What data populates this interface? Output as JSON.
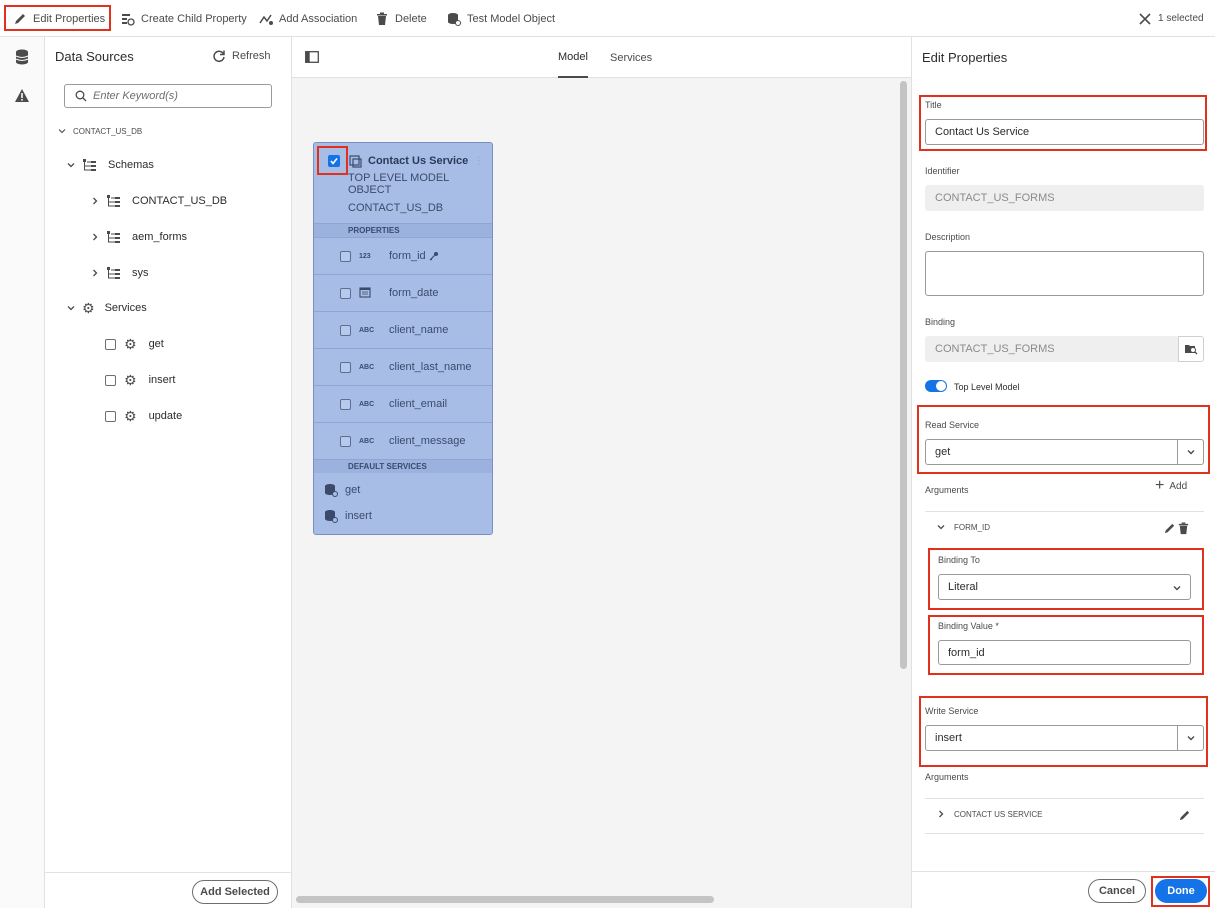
{
  "toolbar": {
    "edit_properties": "Edit Properties",
    "create_child_property": "Create Child Property",
    "add_association": "Add Association",
    "delete": "Delete",
    "test_model_object": "Test Model Object",
    "selected": "1 selected"
  },
  "data_sources": {
    "title": "Data Sources",
    "refresh": "Refresh",
    "search_placeholder": "Enter Keyword(s)",
    "root": "CONTACT_US_DB",
    "schemas_label": "Schemas",
    "schemas": [
      "CONTACT_US_DB",
      "aem_forms",
      "sys"
    ],
    "services_label": "Services",
    "services": [
      "get",
      "insert",
      "update"
    ],
    "add_selected": "Add Selected"
  },
  "canvas": {
    "tabs": [
      "Model",
      "Services"
    ],
    "active_tab": "Model",
    "card": {
      "title": "Contact Us Service",
      "subtitle": "TOP LEVEL MODEL OBJECT",
      "source": "CONTACT_US_DB",
      "properties_label": "PROPERTIES",
      "properties": [
        {
          "type": "123",
          "name": "form_id"
        },
        {
          "type": "date",
          "name": "form_date"
        },
        {
          "type": "ABC",
          "name": "client_name"
        },
        {
          "type": "ABC",
          "name": "client_last_name"
        },
        {
          "type": "ABC",
          "name": "client_email"
        },
        {
          "type": "ABC",
          "name": "client_message"
        }
      ],
      "default_services_label": "DEFAULT SERVICES",
      "default_services": [
        "get",
        "insert"
      ]
    }
  },
  "edit_panel": {
    "heading": "Edit Properties",
    "title_label": "Title",
    "title_value": "Contact Us Service",
    "identifier_label": "Identifier",
    "identifier_value": "CONTACT_US_FORMS",
    "description_label": "Description",
    "description_value": "",
    "binding_label": "Binding",
    "binding_value": "CONTACT_US_FORMS",
    "top_level_label": "Top Level Model",
    "read_service_label": "Read Service",
    "read_service_value": "get",
    "arguments_label": "Arguments",
    "add_label": "Add",
    "argument_name": "FORM_ID",
    "binding_to_label": "Binding To",
    "binding_to_value": "Literal",
    "binding_value_label": "Binding Value *",
    "binding_value_value": "form_id",
    "write_service_label": "Write Service",
    "write_service_value": "insert",
    "write_arguments_label": "Arguments",
    "write_argument_name": "CONTACT US SERVICE",
    "cancel": "Cancel",
    "done": "Done"
  },
  "colors": {
    "accent": "#1473e6",
    "highlight": "#e0301e",
    "card_bg": "#a7bde6"
  }
}
